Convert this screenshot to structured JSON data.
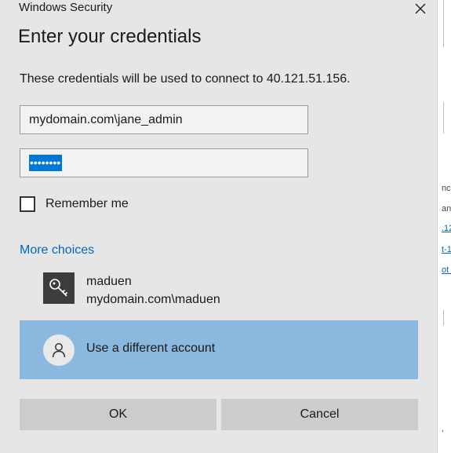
{
  "window": {
    "title": "Windows Security",
    "close_icon": "close-icon"
  },
  "dialog": {
    "heading": "Enter your credentials",
    "description": "These credentials will be used to connect to 40.121.51.156.",
    "username_value": "mydomain.com\\jane_admin",
    "password_mask": "••••••••",
    "remember_label": "Remember me",
    "remember_checked": false,
    "more_choices": "More choices",
    "accounts": [
      {
        "icon": "key-icon",
        "name": "maduen",
        "domain_user": "mydomain.com\\maduen"
      },
      {
        "icon": "user-icon",
        "label": "Use a different account",
        "selected": true
      }
    ],
    "ok_label": "OK",
    "cancel_label": "Cancel"
  },
  "background_window": {
    "fragments": [
      "nc",
      "an",
      ".12",
      "t-1",
      "ot 4",
      ","
    ]
  },
  "colors": {
    "dialog_bg": "#e6e6e6",
    "link": "#0067c0",
    "selected_account_bg": "#8ab8df",
    "button_bg": "#cccccc",
    "selection_highlight": "#0078d7"
  }
}
